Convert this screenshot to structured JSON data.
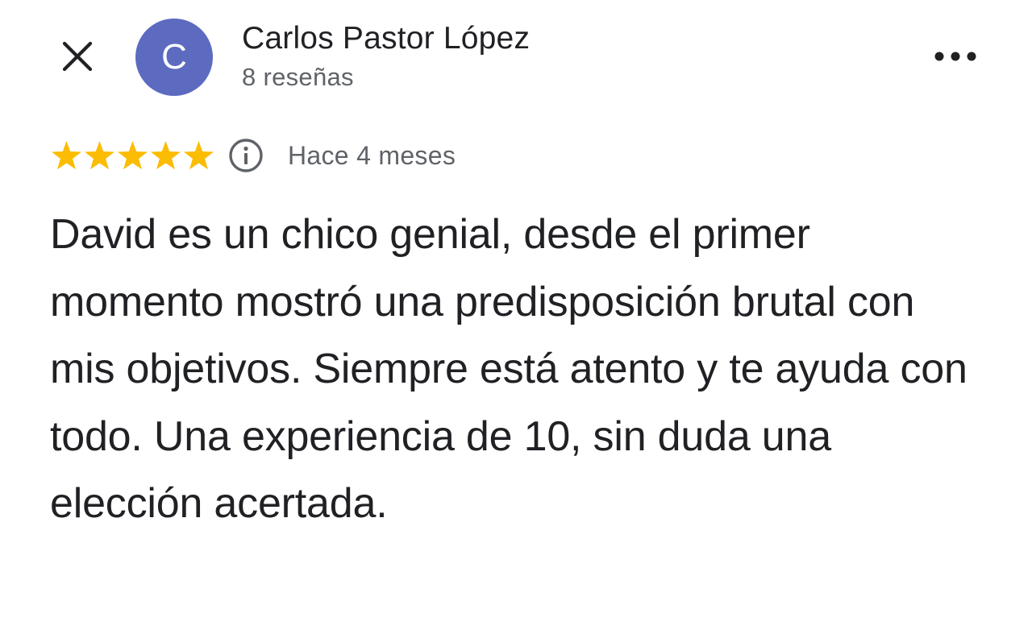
{
  "header": {
    "close_icon": "close-icon",
    "avatar_letter": "C",
    "avatar_color": "#5c6bc0",
    "author_name": "Carlos Pastor López",
    "review_count": "8 reseñas",
    "more_icon": "more-horizontal-icon"
  },
  "review": {
    "rating": 5,
    "max_rating": 5,
    "star_color": "#fbbc04",
    "info_icon": "info-icon",
    "time_ago": "Hace 4 meses",
    "text": "David es un chico genial, desde el primer momento mostró una predisposición brutal con mis objetivos. Siempre está atento y te ayuda con todo. Una experiencia de 10, sin duda una elección acertada."
  }
}
